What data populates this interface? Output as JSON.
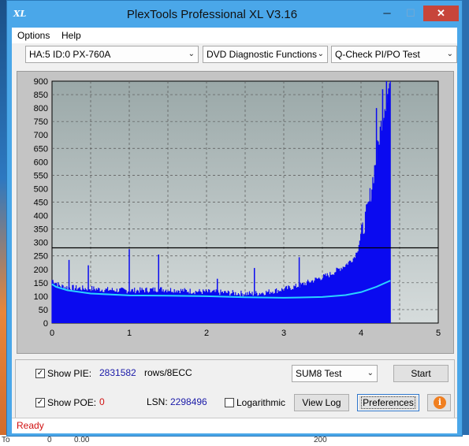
{
  "window": {
    "title": "PlexTools Professional XL V3.16",
    "icon_text": "XL",
    "min_glyph": "─",
    "max_glyph": "☐",
    "close_glyph": "✕"
  },
  "menu": {
    "options": "Options",
    "help": "Help"
  },
  "toolbar": {
    "drive": "HA:5 ID:0  PX-760A",
    "function": "DVD Diagnostic Functions",
    "test": "Q-Check PI/PO Test",
    "arrow": "⌄"
  },
  "chart_data": {
    "type": "area",
    "title": "",
    "xlabel": "",
    "ylabel": "",
    "xlim": [
      0,
      5
    ],
    "ylim": [
      0,
      900
    ],
    "x_ticks": [
      "0",
      "1",
      "2",
      "3",
      "4",
      "5"
    ],
    "y_ticks": [
      "0",
      "50",
      "100",
      "150",
      "200",
      "250",
      "300",
      "350",
      "400",
      "450",
      "500",
      "550",
      "600",
      "650",
      "700",
      "750",
      "800",
      "850",
      "900"
    ],
    "grid": true,
    "threshold": 280,
    "data_end_x": 4.38,
    "colors": {
      "fill": "#0a0af0",
      "line": "#2ad2ff",
      "bg_top": "#9aa8a8",
      "bg_bottom": "#d6dcdc",
      "threshold": "#000000"
    },
    "series": [
      {
        "kind": "fill",
        "x": [
          0,
          0.05,
          0.1,
          0.2,
          0.3,
          0.4,
          0.5,
          0.6,
          0.8,
          1.0,
          1.2,
          1.4,
          1.6,
          1.8,
          2.0,
          2.2,
          2.4,
          2.6,
          2.8,
          3.0,
          3.2,
          3.4,
          3.6,
          3.8,
          3.9,
          4.0,
          4.1,
          4.2,
          4.25,
          4.3,
          4.35,
          4.38
        ],
        "y": [
          150,
          140,
          128,
          122,
          120,
          118,
          118,
          115,
          112,
          110,
          112,
          115,
          112,
          108,
          105,
          103,
          100,
          98,
          105,
          115,
          128,
          150,
          170,
          205,
          230,
          280,
          400,
          580,
          680,
          760,
          820,
          870
        ]
      },
      {
        "kind": "spike",
        "x": [
          0.22,
          0.47,
          1.0,
          1.38,
          2.14,
          2.62,
          3.2,
          4.2,
          4.28,
          4.33
        ],
        "y": [
          235,
          215,
          275,
          255,
          165,
          205,
          245,
          800,
          870,
          900
        ]
      },
      {
        "kind": "line",
        "x": [
          0,
          0.05,
          0.2,
          0.5,
          1.0,
          1.5,
          2.0,
          2.5,
          3.0,
          3.5,
          3.8,
          4.0,
          4.2,
          4.38
        ],
        "y": [
          145,
          135,
          122,
          110,
          103,
          102,
          100,
          96,
          94,
          97,
          104,
          115,
          135,
          158
        ]
      }
    ]
  },
  "controls": {
    "show_pie_label": "Show PIE:",
    "pie_value": "2831582",
    "pie_unit": "rows/8ECC",
    "show_poe_label": "Show POE:",
    "poe_value": "0",
    "lsn_label": "LSN:",
    "lsn_value": "2298496",
    "logarithmic_label": "Logarithmic",
    "test_select": "SUM8 Test",
    "start_button": "Start",
    "view_log_button": "View Log",
    "preferences_button": "Preferences",
    "info_glyph": "i",
    "check_glyph": "✓",
    "show_pie_checked": true,
    "show_poe_checked": true,
    "logarithmic_checked": false
  },
  "status": {
    "text": "Ready"
  },
  "background": {
    "frag1": "To",
    "frag2": "0",
    "frag3": "0.00",
    "frag4": "200"
  }
}
